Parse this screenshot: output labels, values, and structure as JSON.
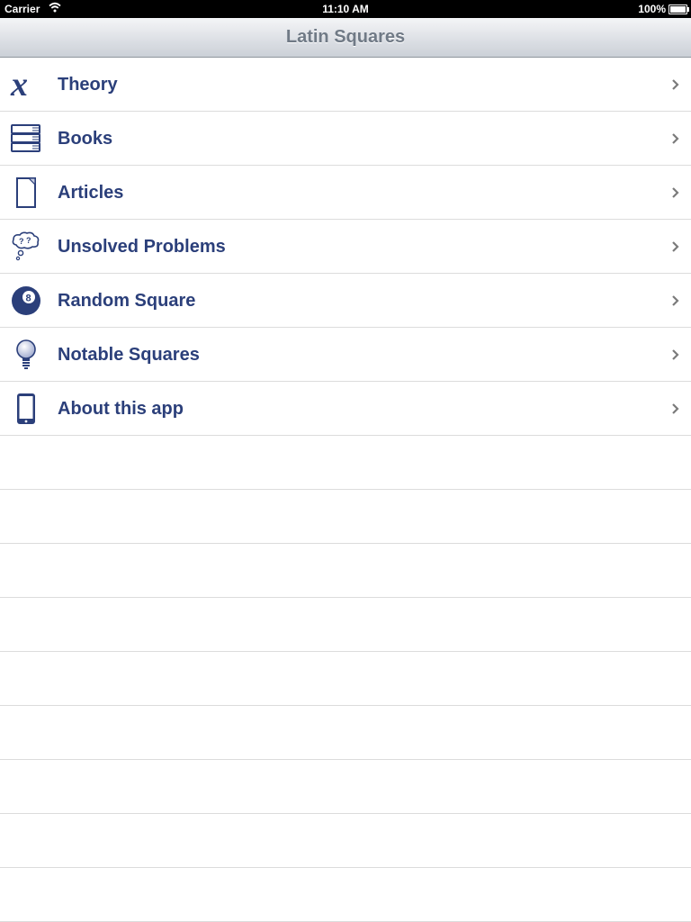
{
  "status": {
    "carrier": "Carrier",
    "time": "11:10 AM",
    "battery": "100%"
  },
  "nav": {
    "title": "Latin Squares"
  },
  "menu": [
    {
      "label": "Theory",
      "icon": "math-x-icon"
    },
    {
      "label": "Books",
      "icon": "books-icon"
    },
    {
      "label": "Articles",
      "icon": "article-icon"
    },
    {
      "label": "Unsolved Problems",
      "icon": "thought-cloud-icon"
    },
    {
      "label": "Random Square",
      "icon": "eight-ball-icon"
    },
    {
      "label": "Notable Squares",
      "icon": "lightbulb-icon"
    },
    {
      "label": "About this app",
      "icon": "ipad-icon"
    }
  ],
  "colors": {
    "label": "#2b3f7a",
    "icon": "#2b3f7a",
    "nav_title": "#707a86"
  }
}
